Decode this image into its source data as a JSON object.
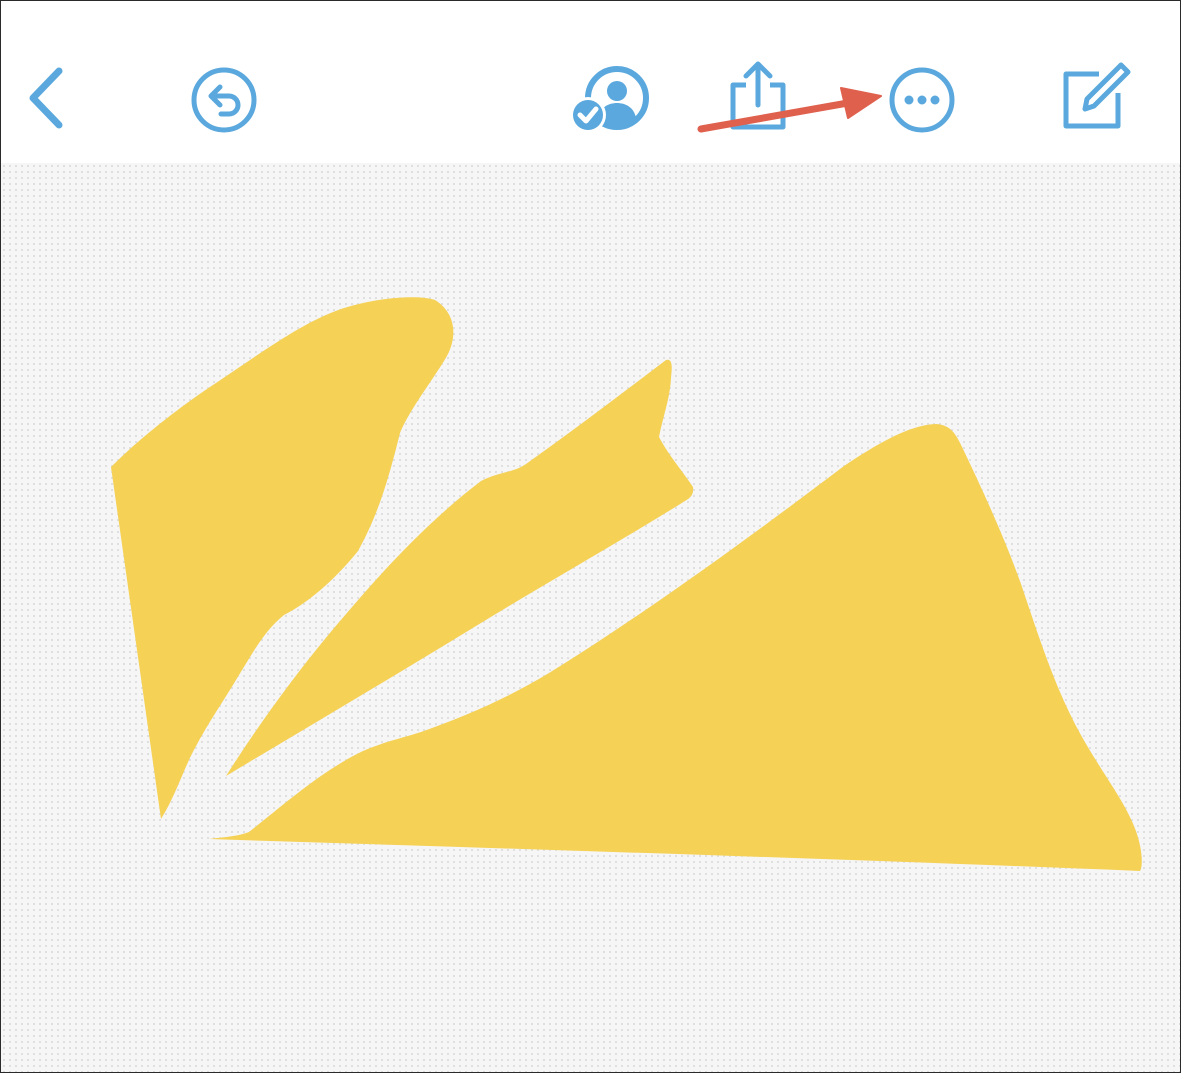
{
  "colors": {
    "toolbar_icon": "#5aa8dd",
    "shape_fill": "#f5d155",
    "annotation_arrow": "#e0604e",
    "canvas_background": "#f6f6f6"
  },
  "toolbar": {
    "buttons": [
      {
        "name": "back-button",
        "icon": "chevron-left-icon"
      },
      {
        "name": "undo-button",
        "icon": "undo-circle-icon"
      },
      {
        "name": "collaborate-button",
        "icon": "person-checkmark-icon"
      },
      {
        "name": "share-button",
        "icon": "share-icon"
      },
      {
        "name": "more-options-button",
        "icon": "ellipsis-circle-icon"
      },
      {
        "name": "new-board-button",
        "icon": "compose-icon"
      }
    ]
  },
  "annotation": {
    "type": "arrow",
    "points_to": "more-options-button"
  },
  "canvas": {
    "shapes": [
      "yellow-freeform-shape-left",
      "yellow-freeform-shape-middle",
      "yellow-freeform-shape-right"
    ]
  }
}
